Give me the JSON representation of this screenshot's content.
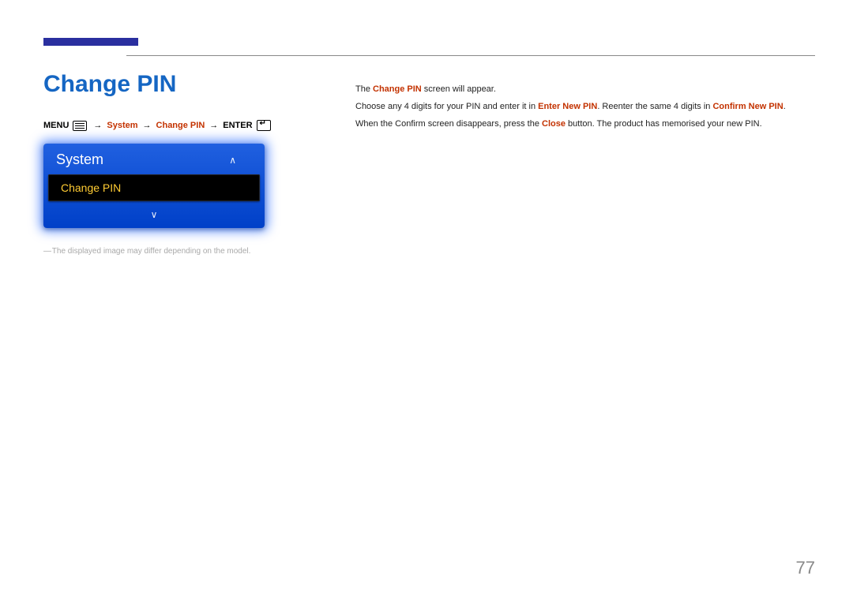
{
  "header": {
    "title": "Change PIN"
  },
  "breadcrumb": {
    "menu": "MENU",
    "system": "System",
    "change_pin": "Change PIN",
    "enter": "ENTER"
  },
  "panel": {
    "title": "System",
    "selected": "Change PIN"
  },
  "disclaimer": "The displayed image may differ depending on the model.",
  "body": {
    "line1_pre": "The ",
    "line1_hl": "Change PIN",
    "line1_post": " screen will appear.",
    "line2_pre": "Choose any 4 digits for your PIN and enter it in ",
    "line2_hl1": "Enter New PIN",
    "line2_mid": ". Reenter the same 4 digits in ",
    "line2_hl2": "Confirm New PIN",
    "line2_post": ".",
    "line3_pre": "When the Confirm screen disappears, press the ",
    "line3_hl": "Close",
    "line3_post": " button. The product has memorised your new PIN."
  },
  "page_number": "77"
}
